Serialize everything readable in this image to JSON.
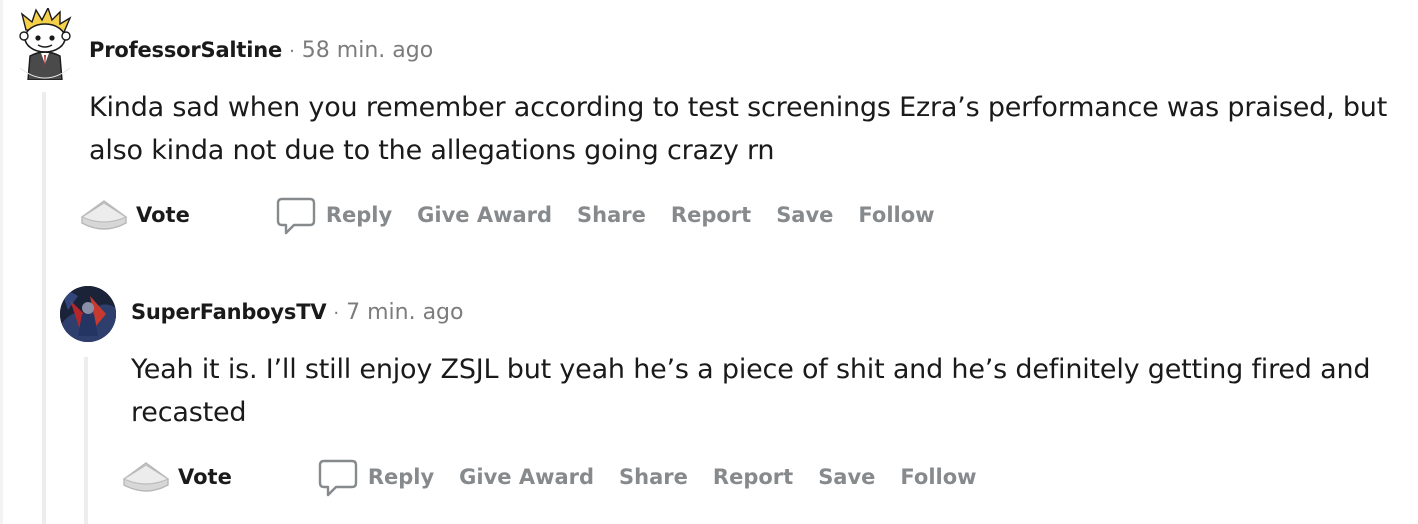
{
  "comments": [
    {
      "username": "ProfessorSaltine",
      "separator": "·",
      "time": "58 min. ago",
      "body": "Kinda sad when you remember according to test screenings Ezra’s performance was praised, but also kinda not due to the allegations going crazy rn",
      "vote_label": "Vote",
      "actions": {
        "reply": "Reply",
        "give_award": "Give Award",
        "share": "Share",
        "report": "Report",
        "save": "Save",
        "follow": "Follow"
      }
    },
    {
      "username": "SuperFanboysTV",
      "separator": "·",
      "time": "7 min. ago",
      "body": "Yeah it is. I’ll still enjoy ZSJL but yeah he’s a piece of shit and he’s definitely getting fired and recasted",
      "vote_label": "Vote",
      "actions": {
        "reply": "Reply",
        "give_award": "Give Award",
        "share": "Share",
        "report": "Report",
        "save": "Save",
        "follow": "Follow"
      }
    }
  ],
  "icons": {
    "vote": "upvote-arrow-icon",
    "reply": "comment-bubble-icon"
  },
  "colors": {
    "text": "#1a1a1b",
    "muted": "#7c7c7c",
    "action": "#878a8c",
    "thread_line": "#ededed"
  }
}
